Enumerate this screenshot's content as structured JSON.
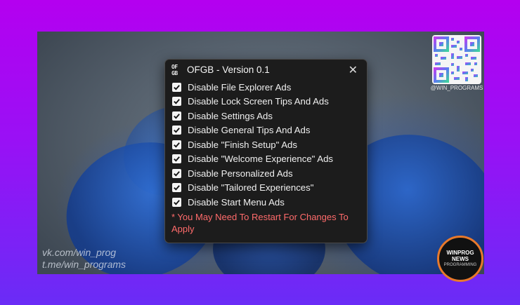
{
  "dialog": {
    "icon_text": "OF\nGB",
    "title": "OFGB - Version 0.1",
    "close_symbol": "✕",
    "options": [
      {
        "label": "Disable File Explorer Ads",
        "checked": true
      },
      {
        "label": "Disable Lock Screen Tips And Ads",
        "checked": true
      },
      {
        "label": "Disable Settings Ads",
        "checked": true
      },
      {
        "label": "Disable General Tips And Ads",
        "checked": true
      },
      {
        "label": "Disable \"Finish Setup\" Ads",
        "checked": true
      },
      {
        "label": "Disable \"Welcome Experience\" Ads",
        "checked": true
      },
      {
        "label": "Disable Personalized Ads",
        "checked": true
      },
      {
        "label": "Disable \"Tailored Experiences\"",
        "checked": true
      },
      {
        "label": "Disable Start Menu Ads",
        "checked": true
      }
    ],
    "warning": "* You May Need To Restart For Changes To Apply"
  },
  "overlay": {
    "qr_handle": "@WIN_PROGRAMS",
    "watermark_line1": "vk.com/win_prog",
    "watermark_line2": "t.me/win_programs",
    "badge_line1": "WINPROG",
    "badge_line2": "NEWS",
    "badge_line3": "PROGRAMMING"
  },
  "colors": {
    "background_top": "#b400f0",
    "background_bottom": "#6a2cf6",
    "dialog_bg": "#1c1c1c",
    "warning": "#ff6b6b",
    "badge_ring": "#e8792b"
  }
}
